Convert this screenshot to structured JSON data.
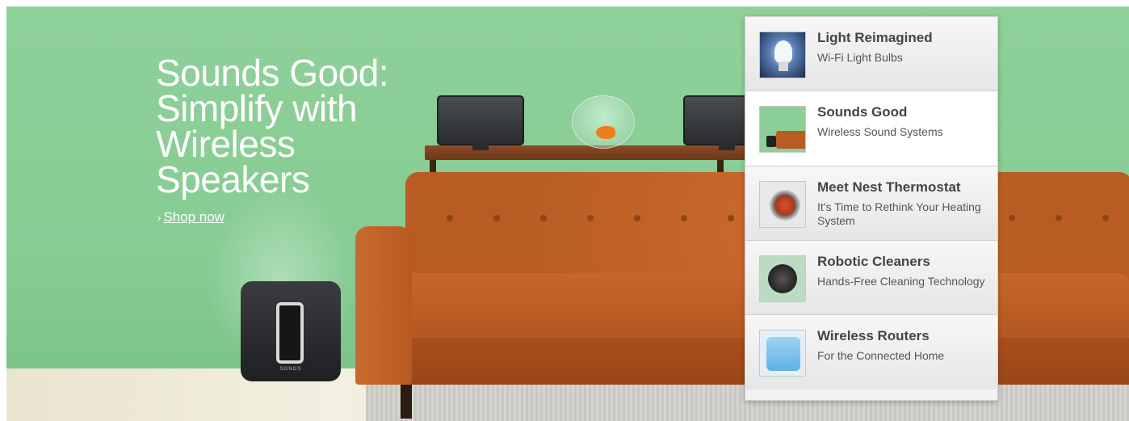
{
  "hero": {
    "headline": "Sounds Good: Simplify with Wireless Speakers",
    "cta_chevron": "›",
    "cta_label": "Shop now",
    "subwoofer_logo": "SONOS"
  },
  "promo_menu": {
    "items": [
      {
        "title": "Light Reimagined",
        "subtitle": "Wi-Fi Light Bulbs",
        "icon": "light-bulb-thumbnail",
        "active": false
      },
      {
        "title": "Sounds Good",
        "subtitle": "Wireless Sound Systems",
        "icon": "sofa-speakers-thumbnail",
        "active": true
      },
      {
        "title": "Meet Nest Thermostat",
        "subtitle": "It's Time to Rethink Your Heating System",
        "icon": "thermostat-thumbnail",
        "active": false
      },
      {
        "title": "Robotic Cleaners",
        "subtitle": "Hands-Free Cleaning Technology",
        "icon": "robot-vacuum-thumbnail",
        "active": false
      },
      {
        "title": "Wireless Routers",
        "subtitle": "For the Connected Home",
        "icon": "router-thumbnail",
        "active": false
      }
    ]
  },
  "colors": {
    "hero_background": "#8fd09a",
    "sofa": "#b85c24",
    "text_white": "#ffffff",
    "menu_background": "#f1f1f1"
  }
}
